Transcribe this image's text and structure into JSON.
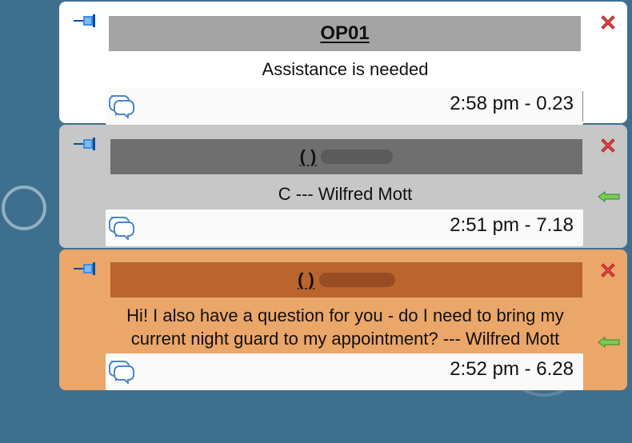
{
  "notifications": [
    {
      "title": "OP01",
      "message": "Assistance is needed",
      "time": "2:58 pm - 0.23"
    },
    {
      "title": "(   )",
      "message": "C --- Wilfred Mott",
      "time": "2:51 pm - 7.18"
    },
    {
      "title": "(   )",
      "message": "Hi! I also have a question for you - do I need to bring my current night guard to my appointment? --- Wilfred Mott",
      "time": "2:52 pm - 6.28"
    }
  ],
  "icons": {
    "pin": "pin-icon",
    "close": "close-icon",
    "chat": "chat-icon",
    "arrow": "arrow-left-icon"
  }
}
